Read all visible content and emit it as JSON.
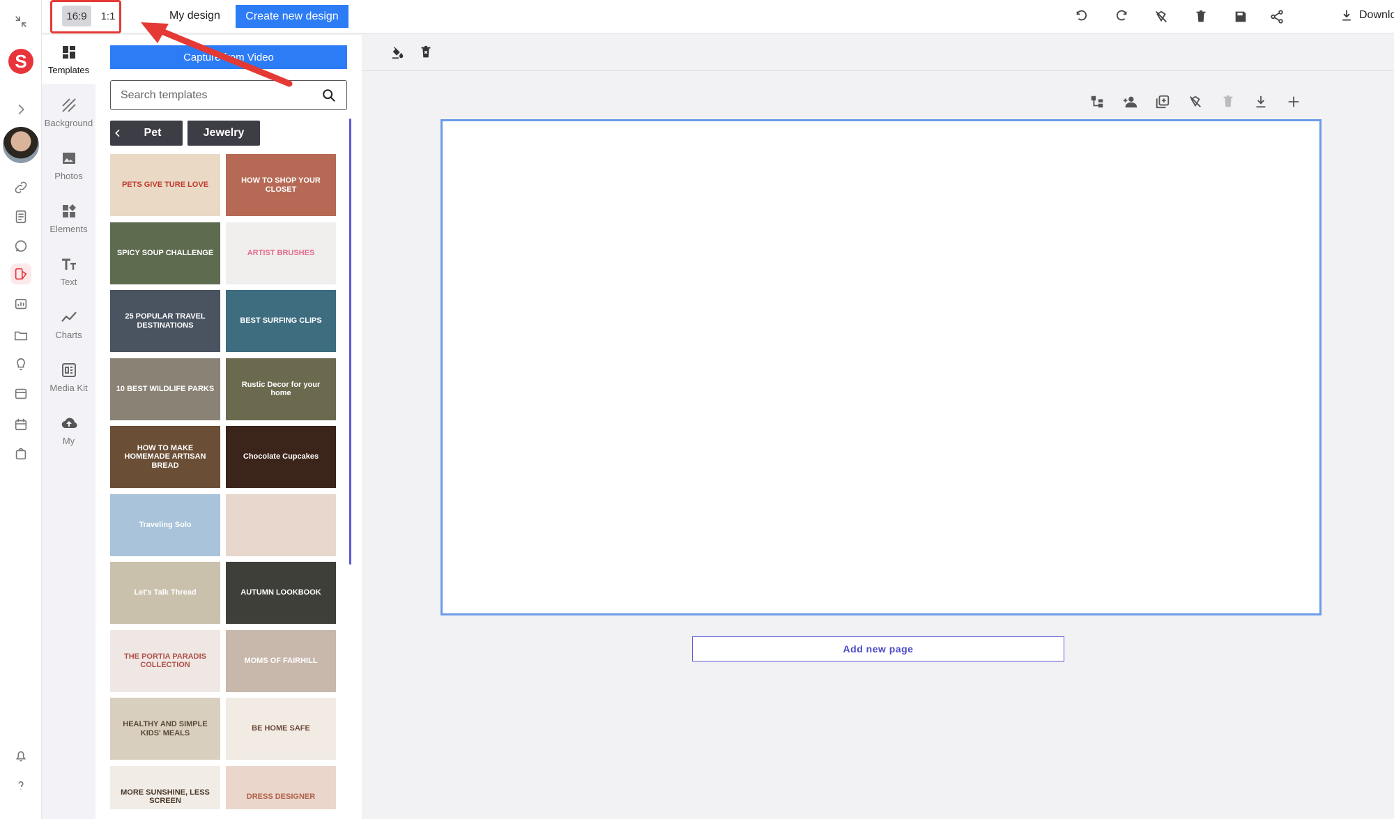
{
  "rail": {
    "logo_letter": "S"
  },
  "categories": [
    {
      "label": "Templates",
      "icon": "templates-icon"
    },
    {
      "label": "Background",
      "icon": "background-icon"
    },
    {
      "label": "Photos",
      "icon": "photos-icon"
    },
    {
      "label": "Elements",
      "icon": "elements-icon"
    },
    {
      "label": "Text",
      "icon": "text-icon"
    },
    {
      "label": "Charts",
      "icon": "charts-icon"
    },
    {
      "label": "Media Kit",
      "icon": "media-kit-icon"
    },
    {
      "label": "My",
      "icon": "cloud-upload-icon"
    }
  ],
  "panel": {
    "capture_label": "Capture from Video",
    "search_placeholder": "Search templates",
    "chips": [
      "Pet",
      "Jewelry"
    ],
    "templates": [
      {
        "title": "PETS GIVE TURE LOVE",
        "bg": "#e9d9c5",
        "fg": "#c0392b"
      },
      {
        "title": "HOW TO SHOP YOUR CLOSET",
        "bg": "#b66a55",
        "fg": "#fff"
      },
      {
        "title": "SPICY SOUP CHALLENGE",
        "bg": "#5d6b4f",
        "fg": "#fff"
      },
      {
        "title": "ARTIST BRUSHES",
        "bg": "#f1efee",
        "fg": "#e46a8a"
      },
      {
        "title": "25 POPULAR TRAVEL DESTINATIONS",
        "bg": "#4a5360",
        "fg": "#fff"
      },
      {
        "title": "BEST SURFING CLIPS",
        "bg": "#3e6d80",
        "fg": "#fff"
      },
      {
        "title": "10 BEST WILDLIFE PARKS",
        "bg": "#8a8375",
        "fg": "#fff"
      },
      {
        "title": "Rustic Decor for your home",
        "bg": "#6b6a4e",
        "fg": "#fff"
      },
      {
        "title": "HOW TO MAKE HOMEMADE ARTISAN BREAD",
        "bg": "#6b4e36",
        "fg": "#fff"
      },
      {
        "title": "Chocolate Cupcakes",
        "bg": "#3b2419",
        "fg": "#fff"
      },
      {
        "title": "Traveling Solo",
        "bg": "#a9c3da",
        "fg": "#fff"
      },
      {
        "title": "",
        "bg": "#e7d7cc",
        "fg": "#fff"
      },
      {
        "title": "Let's Talk Thread",
        "bg": "#c9c1ac",
        "fg": "#fff"
      },
      {
        "title": "AUTUMN LOOKBOOK",
        "bg": "#3f3f3a",
        "fg": "#fff"
      },
      {
        "title": "THE PORTIA PARADIS COLLECTION",
        "bg": "#efe7e3",
        "fg": "#b0504a"
      },
      {
        "title": "MOMS OF FAIRHILL",
        "bg": "#c8b7ab",
        "fg": "#fff"
      },
      {
        "title": "HEALTHY AND SIMPLE KIDS' MEALS",
        "bg": "#d8cfbf",
        "fg": "#5a4a35"
      },
      {
        "title": "BE HOME SAFE",
        "bg": "#f2ebe4",
        "fg": "#6b4a38"
      },
      {
        "title": "MORE SUNSHINE, LESS SCREEN",
        "bg": "#f1ece6",
        "fg": "#4a3a2a"
      },
      {
        "title": "DRESS DESIGNER",
        "bg": "#ead6cb",
        "fg": "#b0604a"
      }
    ]
  },
  "topbar": {
    "ratio_1": "16:9",
    "ratio_2": "1:1",
    "my_design": "My design",
    "create_new": "Create new design",
    "download": "Download"
  },
  "workspace": {
    "add_page": "Add new page"
  },
  "colors": {
    "accent_blue": "#2c7cf6",
    "brand_red": "#e8353b",
    "highlight": "#e53935",
    "canvas_border": "#6a9be8"
  }
}
